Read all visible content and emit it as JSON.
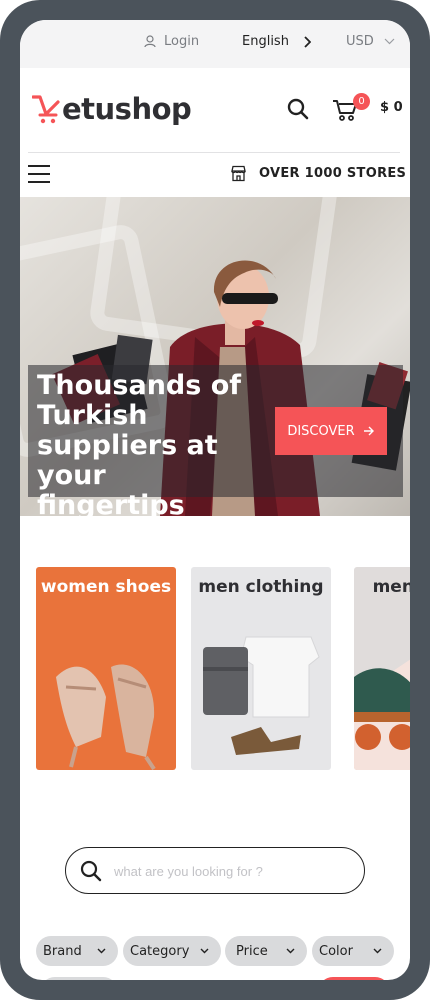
{
  "topbar": {
    "login_label": "Login",
    "language_label": "English",
    "currency_label": "USD"
  },
  "header": {
    "logo_text": "etushop",
    "cart_count": "0",
    "cart_total": "$ 0"
  },
  "nav": {
    "stores_label": "OVER 1000 STORES"
  },
  "hero": {
    "title": "Thousands of Turkish suppliers at your fingertips",
    "cta_label": "DISCOVER"
  },
  "categories": [
    {
      "label": "women shoes"
    },
    {
      "label": "men clothing"
    },
    {
      "label": "men shoes"
    }
  ],
  "search": {
    "placeholder": "what are you looking for ?"
  },
  "filters": [
    {
      "label": "Brand"
    },
    {
      "label": "Category"
    },
    {
      "label": "Price"
    },
    {
      "label": "Color"
    }
  ],
  "colors": {
    "brand_red": "#f55457",
    "frame": "#4b535b"
  }
}
